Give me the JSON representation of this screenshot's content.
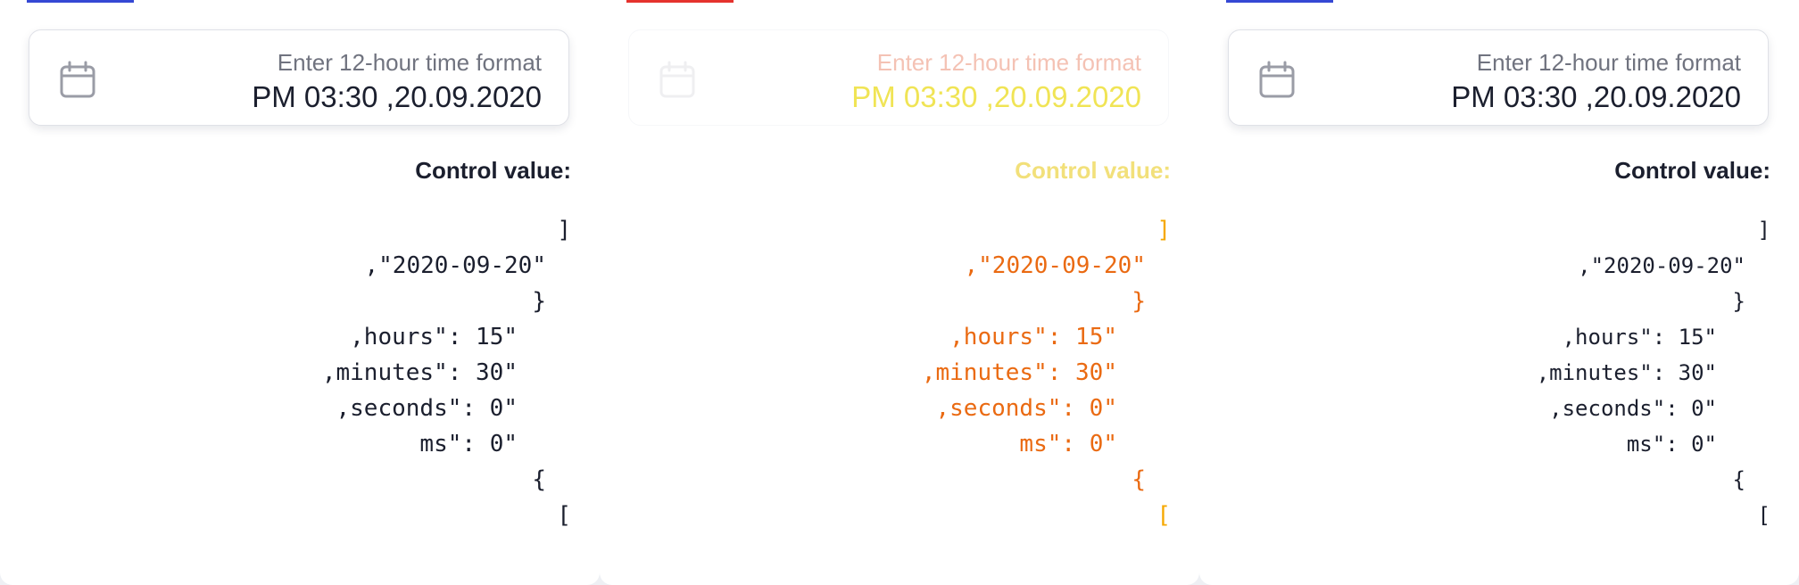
{
  "panels": [
    {
      "accent": "#3548d4",
      "field": {
        "label": "Enter 12-hour time format",
        "value": "PM 03:30 ,20.09.2020",
        "icon": "calendar-icon"
      },
      "control_title": ":Control value",
      "code_lines": [
        "]",
        ",\"2020-09-20\"",
        "}",
        ",hours\": 15\"",
        ",minutes\": 30\"",
        ",seconds\": 0\"",
        "ms\": 0\"",
        "{",
        "["
      ]
    },
    {
      "accent": "#e5322d",
      "field": {
        "label": "Enter 12-hour time format",
        "value": "PM 03:30 ,20.09.2020",
        "icon": "calendar-icon"
      },
      "control_title": ":Control value",
      "code_lines": [
        "]",
        ",\"2020-09-20\"",
        "}",
        ",hours\": 15\"",
        ",minutes\": 30\"",
        ",seconds\": 0\"",
        "ms\": 0\"",
        "{",
        "["
      ]
    },
    {
      "accent": "#3548d4",
      "field": {
        "label": "Enter 12-hour time format",
        "value": "PM 03:30 ,20.09.2020",
        "icon": "calendar-icon"
      },
      "control_title": ":Control value",
      "code_lines": [
        "]",
        ",\"2020-09-20\"",
        "}",
        ",hours\": 15\"",
        ",minutes\": 30\"",
        ",seconds\": 0\"",
        "ms\": 0\"",
        "{",
        "["
      ]
    }
  ]
}
